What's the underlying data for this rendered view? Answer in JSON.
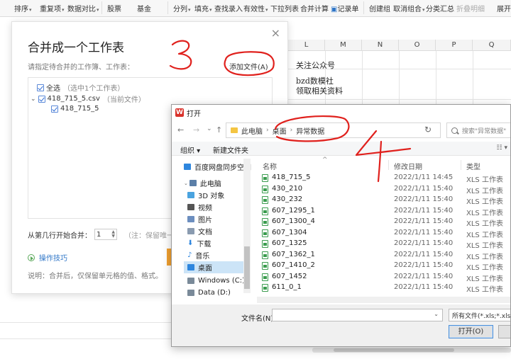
{
  "ribbon": {
    "items": [
      "排序",
      "重复项",
      "数据对比",
      "股票",
      "基金",
      "分列",
      "填充",
      "查找录入",
      "有效性",
      "下拉列表",
      "合并计算",
      "记录单",
      "创建组",
      "取消组合",
      "分类汇总",
      "折叠明细",
      "展开"
    ]
  },
  "sheet": {
    "columns": [
      "L",
      "M",
      "N",
      "O",
      "P",
      "Q"
    ],
    "cells": [
      "关注公众号",
      "bzd数模社",
      "领取相关资料"
    ]
  },
  "merge_dialog": {
    "title": "合并成一个工作表",
    "close": "×",
    "hint": "请指定待合并的工作簿、工作表：",
    "add_file": "添加文件(A)",
    "tree": {
      "select_all": "全选",
      "select_all_note": "（选中1个工作表）",
      "expand": "⌄",
      "file": "418_715_5.csv",
      "file_note": "（当前文件）",
      "sheet": "418_715_5"
    },
    "start_row_label": "从第几行开始合并：",
    "start_row_value": "1",
    "start_row_note": "（注：保留唯一的",
    "tips": "操作技巧",
    "explain": "说明：合并后，仅保留单元格的值、格式。"
  },
  "open_dialog": {
    "title": "打开",
    "logo": "W",
    "nav": {
      "back": "←",
      "forward": "→",
      "caret": "⌄",
      "up": "↑",
      "refresh": "↻"
    },
    "breadcrumb": [
      "此电脑",
      "桌面",
      "异常数据"
    ],
    "search_placeholder": "搜索\"异常数据\"",
    "toolbar": {
      "organize": "组织 ▾",
      "new_folder": "新建文件夹",
      "view": "☷ ▾"
    },
    "nav_pane": [
      {
        "label": "百度网盘同步空间",
        "icon": "cloud-icon",
        "color": "#2e86de"
      },
      {
        "label": "此电脑",
        "icon": "computer-icon",
        "color": "#5b7fa8"
      },
      {
        "label": "3D 对象",
        "icon": "cube-icon",
        "color": "#4aa3df"
      },
      {
        "label": "视频",
        "icon": "video-icon",
        "color": "#555555"
      },
      {
        "label": "图片",
        "icon": "image-icon",
        "color": "#6c8ebf"
      },
      {
        "label": "文档",
        "icon": "document-icon",
        "color": "#8a9bb0"
      },
      {
        "label": "下载",
        "icon": "download-icon",
        "color": "#2e86de"
      },
      {
        "label": "音乐",
        "icon": "music-icon",
        "color": "#2e86de"
      },
      {
        "label": "桌面",
        "icon": "desktop-icon",
        "color": "#2e86de"
      },
      {
        "label": "Windows (C:)",
        "icon": "drive-icon",
        "color": "#7a8a99"
      },
      {
        "label": "Data (D:)",
        "icon": "drive-icon",
        "color": "#7a8a99"
      }
    ],
    "columns": {
      "name": "名称",
      "modified": "修改日期",
      "type": "类型"
    },
    "files": [
      {
        "name": "418_715_5",
        "date": "2022/1/11 14:45",
        "type": "XLS 工作表"
      },
      {
        "name": "430_210",
        "date": "2022/1/11 15:40",
        "type": "XLS 工作表"
      },
      {
        "name": "430_232",
        "date": "2022/1/11 15:40",
        "type": "XLS 工作表"
      },
      {
        "name": "607_1295_1",
        "date": "2022/1/11 15:40",
        "type": "XLS 工作表"
      },
      {
        "name": "607_1300_4",
        "date": "2022/1/11 15:40",
        "type": "XLS 工作表"
      },
      {
        "name": "607_1304",
        "date": "2022/1/11 15:40",
        "type": "XLS 工作表"
      },
      {
        "name": "607_1325",
        "date": "2022/1/11 15:40",
        "type": "XLS 工作表"
      },
      {
        "name": "607_1362_1",
        "date": "2022/1/11 15:40",
        "type": "XLS 工作表"
      },
      {
        "name": "607_1410_2",
        "date": "2022/1/11 15:40",
        "type": "XLS 工作表"
      },
      {
        "name": "607_1452",
        "date": "2022/1/11 15:40",
        "type": "XLS 工作表"
      },
      {
        "name": "611_0_1",
        "date": "2022/1/11 15:40",
        "type": "XLS 工作表"
      }
    ],
    "filename_label": "文件名(N):",
    "filename_value": "",
    "filetype": "所有文件(*.xls;*.xlsx;*",
    "open_button": "打开(O)"
  },
  "annotations": {
    "step3": "3",
    "step4": "4",
    "color": "#e0211d"
  }
}
